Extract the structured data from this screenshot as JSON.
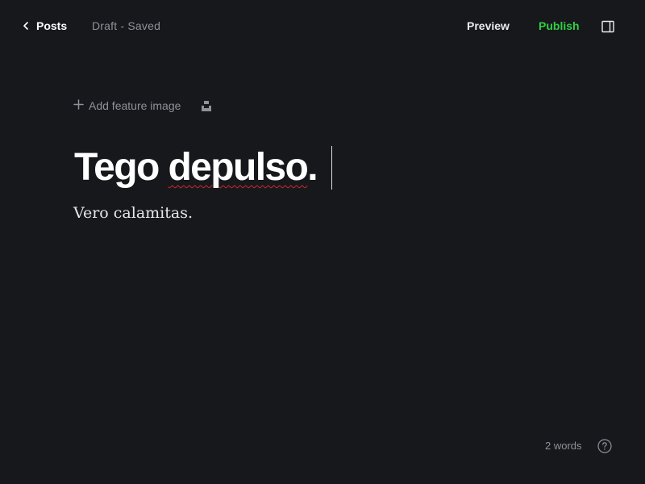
{
  "header": {
    "back_label": "Posts",
    "status": "Draft - Saved",
    "preview_label": "Preview",
    "publish_label": "Publish",
    "publish_color": "#30cf43"
  },
  "editor": {
    "add_feature_image_label": "Add feature image",
    "title_part1": "Tego ",
    "title_part2": "depulso",
    "title_part3": ".",
    "body": "Vero calamitas."
  },
  "footer": {
    "word_count": "2 words"
  },
  "icons": {
    "back": "chevron-left-icon",
    "sidebar": "sidebar-toggle-icon",
    "add": "plus-icon",
    "unsplash": "unsplash-icon",
    "help": "help-circle-icon"
  },
  "colors": {
    "background": "#17181c",
    "muted_text": "#8e9299",
    "spellcheck": "#d12828"
  }
}
